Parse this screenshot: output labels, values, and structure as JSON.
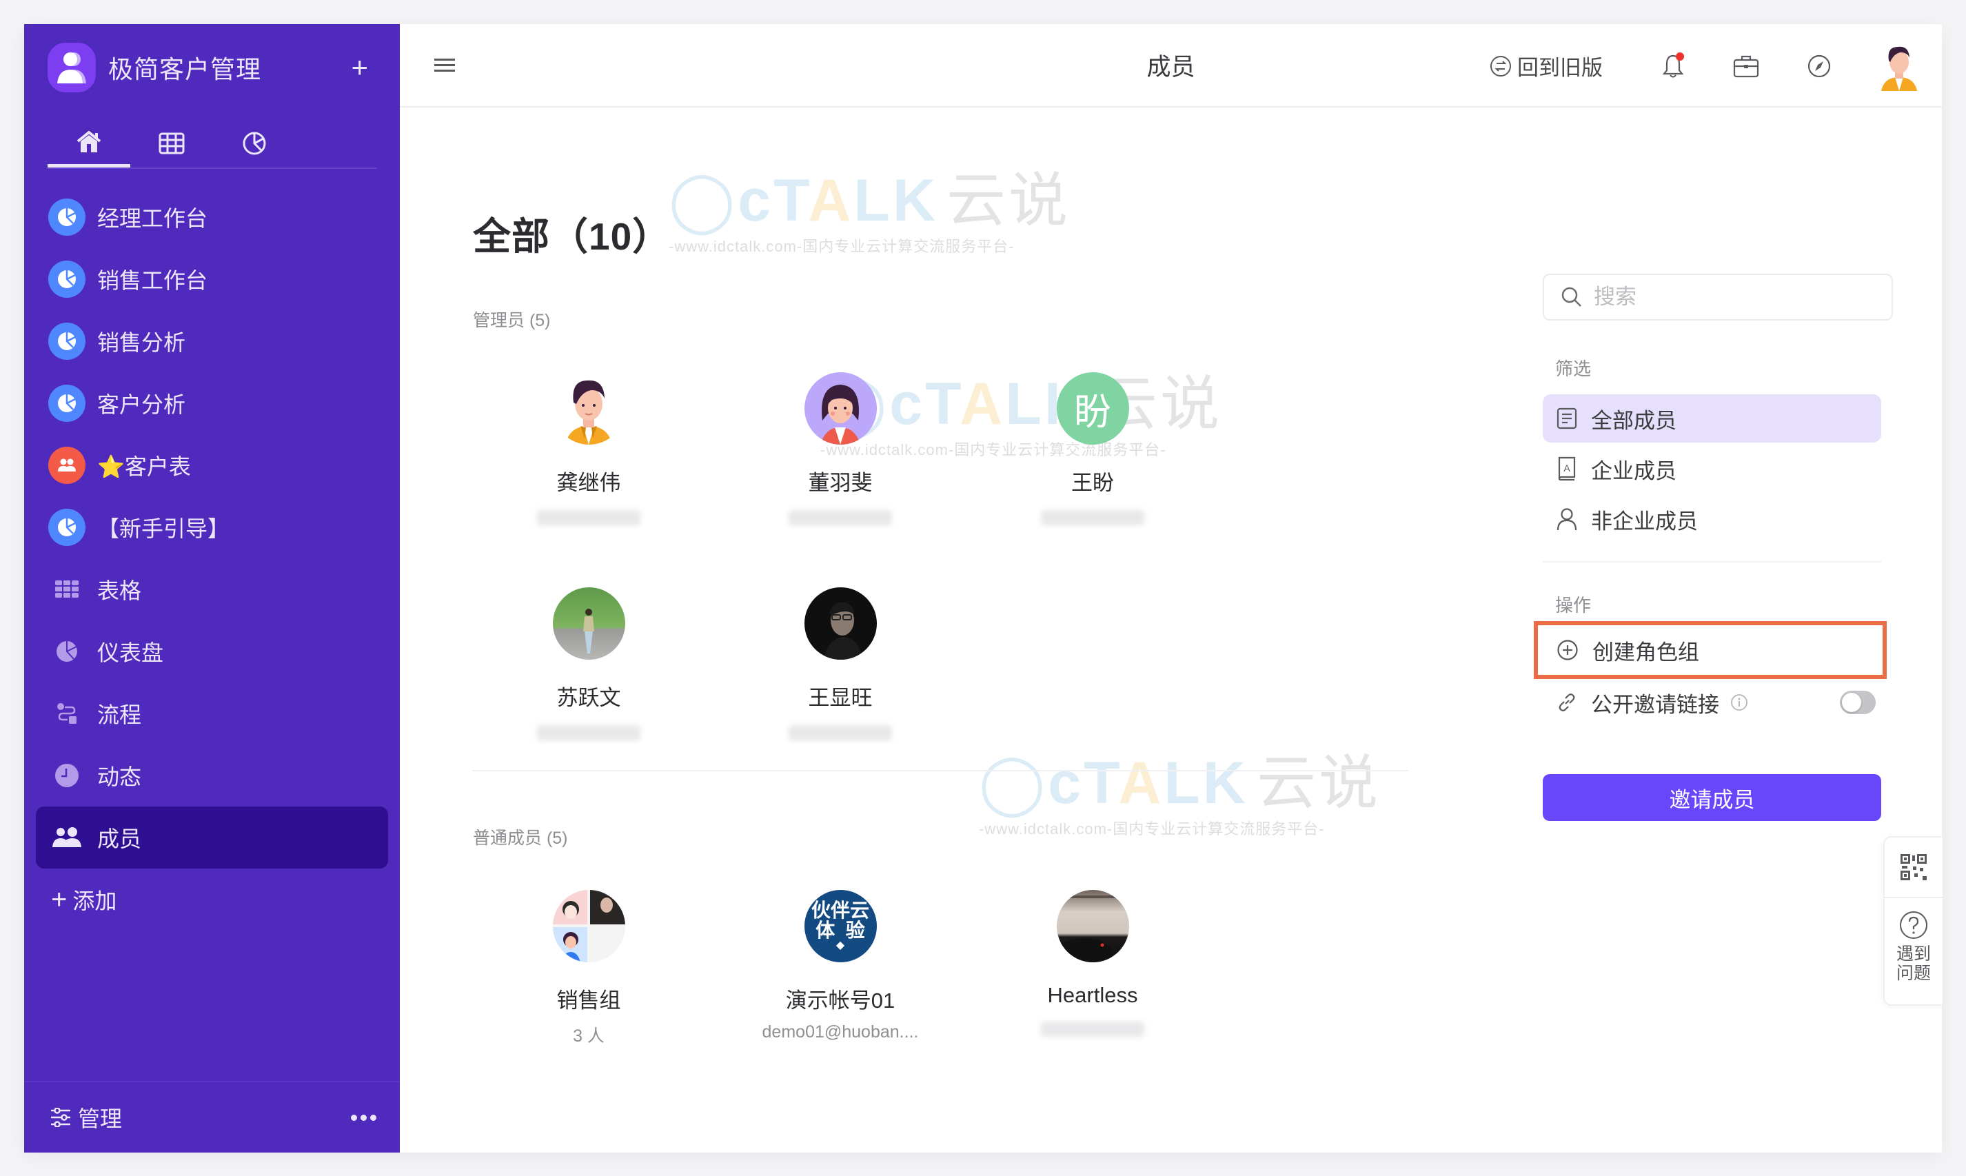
{
  "app": {
    "title": "极简客户管理",
    "add_icon": "plus-icon"
  },
  "sidebar": {
    "tabs": [
      {
        "icon": "home-icon",
        "active": true
      },
      {
        "icon": "table-icon",
        "active": false
      },
      {
        "icon": "dashboard-icon",
        "active": false
      }
    ],
    "items": [
      {
        "label": "经理工作台",
        "icon": "dashboard-icon",
        "icon_bg": "#4f87ff"
      },
      {
        "label": "销售工作台",
        "icon": "dashboard-icon",
        "icon_bg": "#4f87ff"
      },
      {
        "label": "销售分析",
        "icon": "dashboard-icon",
        "icon_bg": "#4f87ff"
      },
      {
        "label": "客户分析",
        "icon": "dashboard-icon",
        "icon_bg": "#4f87ff"
      },
      {
        "label": "⭐客户表",
        "icon": "users-icon",
        "icon_bg": "#f35a48"
      },
      {
        "label": "【新手引导】",
        "icon": "dashboard-icon",
        "icon_bg": "#4f87ff"
      },
      {
        "label": "表格",
        "icon": "grid-icon"
      },
      {
        "label": "仪表盘",
        "icon": "pie-chart-icon"
      },
      {
        "label": "流程",
        "icon": "workflow-icon"
      },
      {
        "label": "动态",
        "icon": "clock-icon"
      },
      {
        "label": "成员",
        "icon": "members-icon",
        "active": true
      }
    ],
    "add_label": "添加",
    "footer": {
      "manage_label": "管理",
      "more_icon": "more-icon"
    }
  },
  "header": {
    "page_name": "成员",
    "old_version_label": "回到旧版",
    "notification_badge": true
  },
  "main": {
    "title": "全部（10）",
    "admins": {
      "label": "管理员 (5)",
      "members": [
        {
          "name": "龚继伟",
          "sub": "blurred-phone",
          "avatar": "cartoon-man"
        },
        {
          "name": "董羽斐",
          "sub": "blurred-phone",
          "avatar": "cartoon-woman"
        },
        {
          "name": "王盼",
          "sub": "blurred-phone",
          "avatar_text": "盼",
          "avatar_color": "#7fd4a2"
        },
        {
          "name": "苏跃文",
          "sub": "blurred-phone",
          "avatar": "photo-outdoor"
        },
        {
          "name": "王显旺",
          "sub": "blurred-phone",
          "avatar": "photo-portrait"
        }
      ]
    },
    "regular": {
      "label": "普通成员 (5)",
      "members": [
        {
          "name": "销售组",
          "sub": "3 人",
          "avatar": "group-collage"
        },
        {
          "name": "演示帐号01",
          "sub": "demo01@huoban....",
          "avatar_text": "伙伴云体验",
          "avatar_color": "#134a82"
        },
        {
          "name": "Heartless",
          "sub": "blurred-phone",
          "avatar": "photo-car"
        }
      ]
    },
    "watermark": {
      "logo": "TALK",
      "logo_cn": "云说",
      "url_text": "-www.idctalk.com-国内专业云计算交流服务平台-"
    }
  },
  "right_panel": {
    "search": {
      "placeholder": "搜索",
      "value": ""
    },
    "filter_label": "筛选",
    "filters": [
      {
        "label": "全部成员",
        "icon": "list-icon",
        "active": true
      },
      {
        "label": "企业成员",
        "icon": "contacts-book-icon",
        "active": false
      },
      {
        "label": "非企业成员",
        "icon": "person-icon",
        "active": false
      }
    ],
    "operations_label": "操作",
    "operations": [
      {
        "label": "创建角色组",
        "icon": "plus-circle-icon",
        "highlighted": true
      },
      {
        "label": "公开邀请链接",
        "icon": "link-icon",
        "toggle": false
      }
    ],
    "invite_button": "邀请成员"
  },
  "float_help": {
    "qr_icon": "qr-code-icon",
    "help_label": "遇到问题"
  },
  "colors": {
    "sidebar_bg": "#5029bd",
    "sidebar_active": "#2e0f91",
    "accent": "#6746fb",
    "filter_active_bg": "#e6e0fd",
    "highlight_outline": "#ea6d46"
  }
}
